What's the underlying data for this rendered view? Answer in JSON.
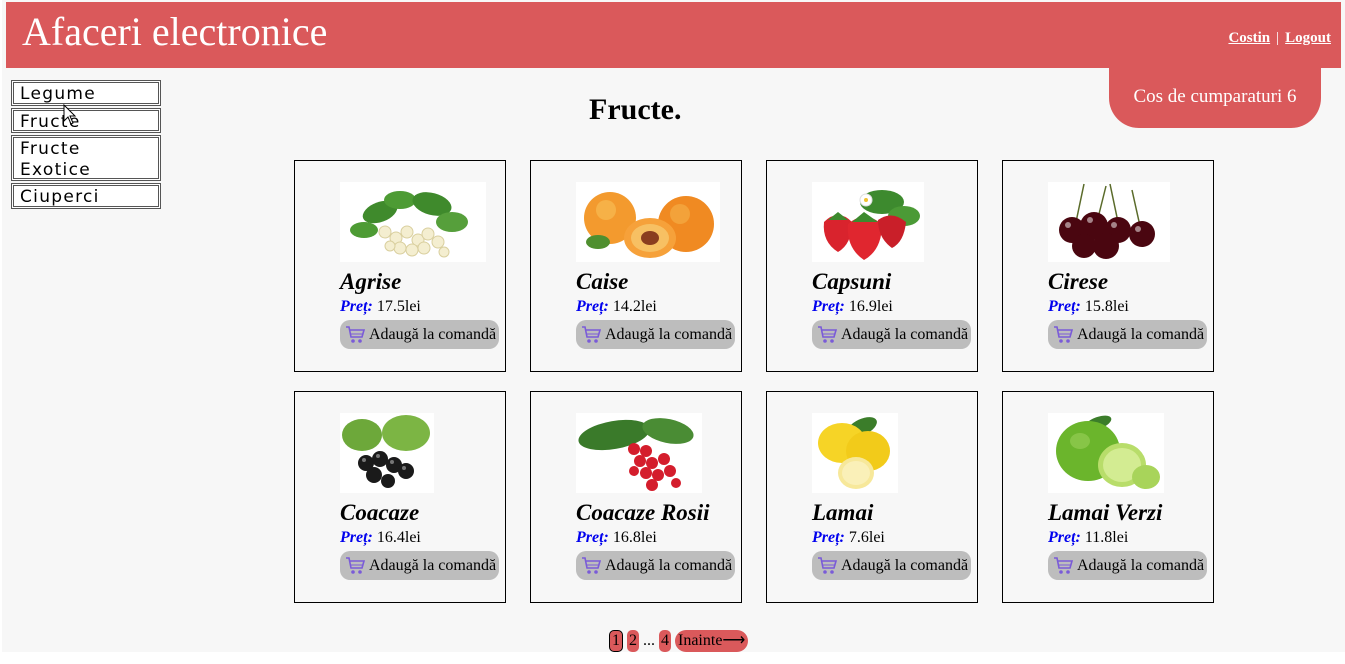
{
  "header": {
    "title": "Afaceri electronice",
    "user": "Costin",
    "separator": "|",
    "logout": "Logout",
    "bg_color": "#da595b"
  },
  "cart": {
    "label": "Cos de cumparaturi 6"
  },
  "sidebar": {
    "items": [
      {
        "label": "Legume"
      },
      {
        "label": "Fructe"
      },
      {
        "label": "Fructe Exotice"
      },
      {
        "label": "Ciuperci"
      }
    ]
  },
  "page": {
    "title": "Fructe."
  },
  "product_labels": {
    "price": "Preț:",
    "currency": "lei",
    "add_to_order": "Adaugă la comandă"
  },
  "products": [
    {
      "name": "Agrise",
      "price": "17.5",
      "icon": "white-currant-image"
    },
    {
      "name": "Caise",
      "price": "14.2",
      "icon": "apricot-image"
    },
    {
      "name": "Capsuni",
      "price": "16.9",
      "icon": "strawberry-image"
    },
    {
      "name": "Cirese",
      "price": "15.8",
      "icon": "cherry-image"
    },
    {
      "name": "Coacaze",
      "price": "16.4",
      "icon": "blackcurrant-image"
    },
    {
      "name": "Coacaze Rosii",
      "price": "16.8",
      "icon": "redcurrant-image"
    },
    {
      "name": "Lamai",
      "price": "7.6",
      "icon": "lemon-image"
    },
    {
      "name": "Lamai Verzi",
      "price": "11.8",
      "icon": "lime-image"
    }
  ],
  "pagination": {
    "pages": [
      "1",
      "2",
      "4"
    ],
    "ellipsis": "...",
    "next": "Inainte⟶",
    "current": "1"
  }
}
